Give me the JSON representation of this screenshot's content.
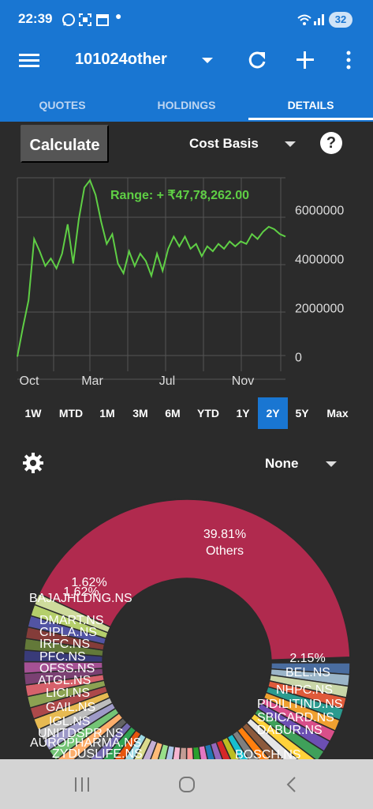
{
  "status": {
    "time": "22:39",
    "battery": "32"
  },
  "app_bar": {
    "portfolio_name": "101024other"
  },
  "tabs": [
    {
      "label": "QUOTES",
      "active": false
    },
    {
      "label": "HOLDINGS",
      "active": false
    },
    {
      "label": "DETAILS",
      "active": true
    }
  ],
  "controls": {
    "calculate_label": "Calculate",
    "basis_value": "Cost Basis",
    "help_glyph": "?"
  },
  "chart_data": {
    "type": "line",
    "range_label": "Range: + ₹47,78,262.00",
    "x_ticks": [
      "Oct",
      "Mar",
      "Jul",
      "Nov"
    ],
    "y_ticks": [
      "6000000",
      "4000000",
      "2000000",
      "0"
    ],
    "ylim": [
      -600000,
      7300000
    ],
    "grid": true,
    "color": "#5fcf45",
    "series": [
      {
        "x": [
          0,
          0.5,
          1,
          1.5,
          2,
          2.5,
          3,
          3.5,
          4,
          4.5,
          5,
          5.5,
          6,
          6.5,
          7,
          7.5,
          8,
          8.5,
          9,
          9.5,
          10,
          10.5,
          11,
          11.5,
          12,
          12.5,
          13,
          13.5,
          14,
          14.5,
          15,
          15.5,
          16,
          16.5,
          17,
          17.5,
          18,
          18.5,
          19,
          19.5,
          20,
          20.5,
          21,
          21.5,
          22,
          22.5,
          23,
          23.5,
          24
        ],
        "y": [
          0,
          1200000,
          2300000,
          4800000,
          4300000,
          3700000,
          4000000,
          3600000,
          4200000,
          5400000,
          3800000,
          5600000,
          6900000,
          7200000,
          6600000,
          5500000,
          4600000,
          5000000,
          3800000,
          3400000,
          4300000,
          3700000,
          4200000,
          3900000,
          3300000,
          4200000,
          3500000,
          4400000,
          4900000,
          4500000,
          4900000,
          4400000,
          4600000,
          4100000,
          4500000,
          4300000,
          4600000,
          4400000,
          4700000,
          4500000,
          4700000,
          4600000,
          5000000,
          4800000,
          5100000,
          5300000,
          5200000,
          5000000,
          4900000
        ]
      }
    ]
  },
  "range_buttons": [
    {
      "label": "1W"
    },
    {
      "label": "MTD"
    },
    {
      "label": "1M"
    },
    {
      "label": "3M"
    },
    {
      "label": "6M"
    },
    {
      "label": "YTD"
    },
    {
      "label": "1Y"
    },
    {
      "label": "2Y",
      "selected": true
    },
    {
      "label": "5Y"
    },
    {
      "label": "Max"
    }
  ],
  "grouping": {
    "value": "None"
  },
  "allocation": {
    "others_pct": "39.81%",
    "others_label": "Others",
    "right_pct": "2.15%",
    "left_pct": "1.62%",
    "left_pct_2": "1.62%",
    "labels_left": [
      "BAJAJHLDNG.NS",
      "DMART.NS",
      "CIPLA.NS",
      "IRFC.NS",
      "PFC.NS",
      "OFSS.NS",
      "ATGL.NS",
      "LICI.NS",
      "GAIL.NS",
      "IGL.NS",
      "UNITDSPR.NS",
      "AUROPHARMA.NS",
      "ZYDUSLIFE.NS"
    ],
    "labels_right": [
      "BEL.NS",
      "NHPC.NS",
      "PIDILITIND.NS",
      "SBICARD.NS",
      "DABUR.NS",
      "BOSCH.NS"
    ]
  }
}
